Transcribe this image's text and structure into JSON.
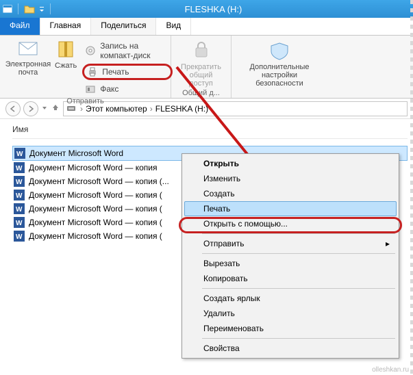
{
  "window": {
    "title": "FLESHKA (H:)"
  },
  "tabs": {
    "file": "Файл",
    "home": "Главная",
    "share": "Поделиться",
    "view": "Вид"
  },
  "ribbon": {
    "email": "Электронная почта",
    "zip": "Сжать",
    "burn": "Запись на компакт-диск",
    "print": "Печать",
    "fax": "Факс",
    "send_group": "Отправить",
    "stop_share": "Прекратить общий доступ",
    "share_group": "Общий д...",
    "security": "Дополнительные настройки безопасности"
  },
  "breadcrumb": {
    "pc": "Этот компьютер",
    "drive": "FLESHKA (H:)"
  },
  "columns": {
    "name": "Имя"
  },
  "files": [
    "Документ Microsoft Word",
    "Документ Microsoft Word — копия",
    "Документ Microsoft Word — копия (...",
    "Документ Microsoft Word — копия (",
    "Документ Microsoft Word — копия (",
    "Документ Microsoft Word — копия (",
    "Документ Microsoft Word — копия ("
  ],
  "context_menu": {
    "open": "Открыть",
    "edit": "Изменить",
    "new": "Создать",
    "print": "Печать",
    "open_with": "Открыть с помощью...",
    "send_to": "Отправить",
    "cut": "Вырезать",
    "copy": "Копировать",
    "shortcut": "Создать ярлык",
    "delete": "Удалить",
    "rename": "Переименовать",
    "properties": "Свойства"
  },
  "watermark": "olleshkan.ru"
}
